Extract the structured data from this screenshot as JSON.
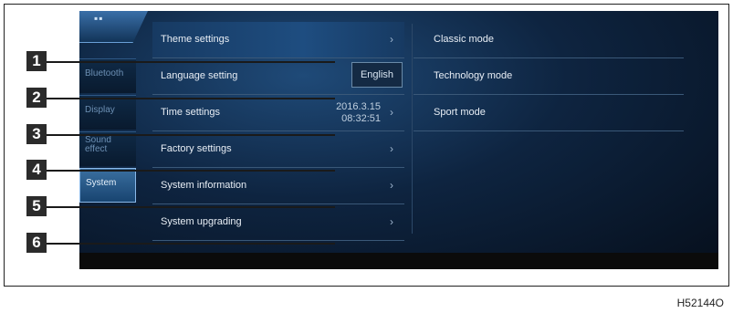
{
  "left_nav": {
    "items": [
      {
        "label": "Bluetooth"
      },
      {
        "label": "Display"
      },
      {
        "label": "Sound effect"
      },
      {
        "label": "System"
      }
    ]
  },
  "menu": {
    "theme": {
      "label": "Theme settings"
    },
    "language": {
      "label": "Language setting",
      "value": "English"
    },
    "time": {
      "label": "Time settings",
      "date": "2016.3.15",
      "time": "08:32:51"
    },
    "factory": {
      "label": "Factory settings"
    },
    "sysinfo": {
      "label": "System information"
    },
    "upgrade": {
      "label": "System upgrading"
    }
  },
  "modes": [
    "Classic mode",
    "Technology mode",
    "Sport mode"
  ],
  "callouts": [
    "1",
    "2",
    "3",
    "4",
    "5",
    "6"
  ],
  "figure_code": "H52144O"
}
